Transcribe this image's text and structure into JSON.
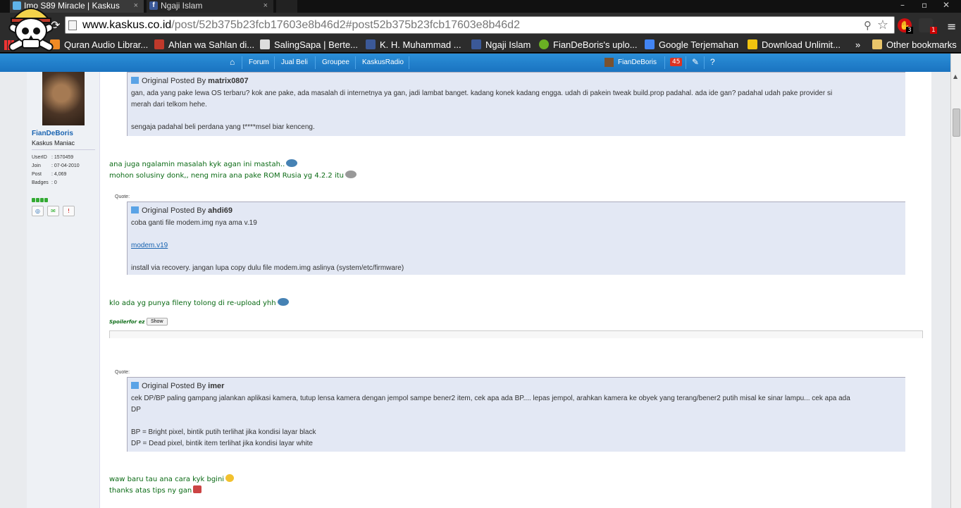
{
  "tabs": [
    {
      "title": "Imo S89 Miracle | Kaskus",
      "close": "×"
    },
    {
      "title": "Ngaji Islam",
      "close": "×"
    }
  ],
  "window_controls": {
    "minimize": "–",
    "maximize": "▫",
    "close": "✕"
  },
  "address_bar": {
    "host": "www.kaskus.co.id",
    "path": "/post/52b375b23fcb17603e8b46d2#post52b375b23fcb17603e8b46d2"
  },
  "extensions": [
    {
      "badge": "3"
    },
    {
      "badge": "1"
    }
  ],
  "bookmarks": [
    {
      "label": "Quran Audio Librar...",
      "icon_color": "#f08a24"
    },
    {
      "label": "Ahlan wa Sahlan di...",
      "icon_color": "#c0392b"
    },
    {
      "label": "SalingSapa | Berte...",
      "icon_color": "#dddddd"
    },
    {
      "label": "K. H. Muhammad ...",
      "icon_color": "#3b5998"
    },
    {
      "label": "Ngaji Islam",
      "icon_color": "#3b5998"
    },
    {
      "label": "FianDeBoris's uplo...",
      "icon_color": "#6ab023"
    },
    {
      "label": "Google Terjemahan",
      "icon_color": "#4285f4"
    },
    {
      "label": "Download Unlimit...",
      "icon_color": "#f1c40f"
    }
  ],
  "bookmarks_more": "»",
  "other_bookmarks": "Other bookmarks",
  "site_nav": {
    "items": [
      "Forum",
      "Jual Beli",
      "Groupee",
      "KaskusRadio"
    ],
    "user": "FianDeBoris",
    "notifications": "45"
  },
  "user": {
    "name": "FianDeBoris",
    "title": "Kaskus Maniac",
    "stats": [
      {
        "k": "UserID",
        "v": ": 1570459"
      },
      {
        "k": "Join",
        "v": ": 07-04-2010"
      },
      {
        "k": "Post",
        "v": ": 4,069"
      },
      {
        "k": "Badges",
        "v": ": 0"
      }
    ]
  },
  "quote_label": "Quote:",
  "original_posted_by": "Original Posted By",
  "quotes": [
    {
      "author": "matrix0807",
      "lines": [
        "gan, ada yang pake lewa OS terbaru? kok ane pake, ada masalah di internetnya ya gan, jadi lambat banget. kadang konek kadang engga. udah di pakein tweak build.prop padahal. ada ide gan? padahal udah pake provider si",
        "merah dari telkom hehe.",
        "",
        "sengaja padahal beli perdana yang t****msel biar kenceng."
      ]
    },
    {
      "author": "ahdi69",
      "lines": [
        "coba ganti file modem.img nya ama v.19",
        "",
        "modem.v19",
        "",
        "install via recovery. jangan lupa copy dulu file modem.img aslinya (system/etc/firmware)"
      ]
    },
    {
      "author": "imer",
      "lines": [
        "cek DP/BP paling gampang jalankan aplikasi kamera, tutup lensa kamera dengan jempol sampe bener2 item, cek apa ada BP.... lepas jempol, arahkan kamera ke obyek yang terang/bener2 putih misal ke sinar lampu... cek apa ada",
        "DP",
        "",
        "BP = Bright pixel, bintik putih terlihat jika kondisi layar black",
        "DP = Dead pixel, bintik item terlihat jika kondisi layar white"
      ]
    }
  ],
  "posts": [
    "ana juga ngalamin masalah kyk agan ini mastah..",
    "mohon solusiny donk,, neng mira ana pake ROM Rusia yg 4.2.2 itu",
    "klo ada yg punya fileny tolong di re-upload yhh",
    "waw baru tau ana cara kyk bgini",
    "thanks atas tips ny gan"
  ],
  "spoiler": {
    "label": "Spoilerfor ez",
    "button": "Show"
  }
}
